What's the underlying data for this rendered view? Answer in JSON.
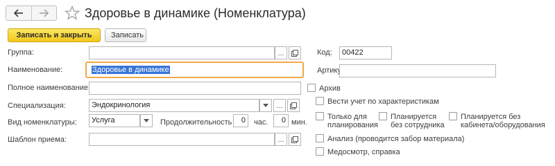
{
  "window": {
    "title": "Здоровье в динамике (Номенклатура)"
  },
  "toolbar": {
    "save_close_label": "Записать и закрыть",
    "save_label": "Записать"
  },
  "form": {
    "group": {
      "label": "Группа:",
      "value": ""
    },
    "code": {
      "label": "Код:",
      "value": "00422"
    },
    "name": {
      "label": "Наименование:",
      "value": "Здоровье в динамике"
    },
    "article": {
      "label": "Артикул:",
      "value": ""
    },
    "full_name": {
      "label": "Полное наименование:",
      "value": ""
    },
    "specialization": {
      "label": "Специализация:",
      "value": "Эндокринология"
    },
    "nomenclature_type": {
      "label": "Вид номенклатуры:",
      "value": "Услуга"
    },
    "duration": {
      "label": "Продолжительность",
      "hours": "0",
      "hours_unit": "час.",
      "minutes": "0",
      "minutes_unit": "мин."
    },
    "template": {
      "label": "Шаблон приема:",
      "value": ""
    },
    "ellipsis": "...",
    "copy_icon_label": "⧉"
  },
  "checks": {
    "archive": "Архив",
    "track_characteristics": "Вести учет по характеристикам",
    "planning_only_line1": "Только для",
    "planning_only_line2": "планирования",
    "no_staff_line1": "Планируется",
    "no_staff_line2": "без сотрудника",
    "no_cabinet_line1": "Планируется без",
    "no_cabinet_line2": "кабинета/оборудования",
    "analysis": "Анализ (проводится забор материала)",
    "med_exam": "Медосмотр, справка"
  }
}
